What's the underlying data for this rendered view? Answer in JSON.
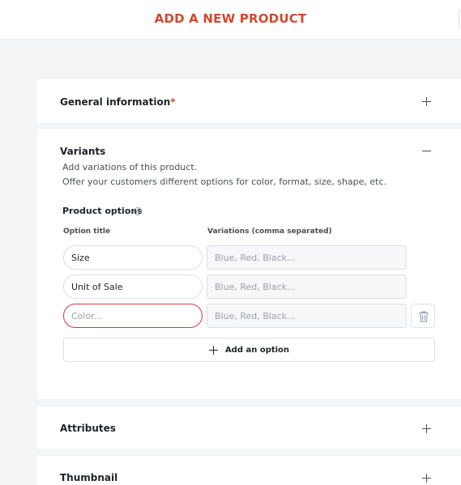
{
  "header": {
    "title": "ADD A NEW PRODUCT"
  },
  "sections": {
    "general": {
      "title": "General information",
      "required_mark": "*"
    },
    "variants": {
      "title": "Variants",
      "description_line1": "Add variations of this product.",
      "description_line2": "Offer your customers different options for color, format, size, shape, etc.",
      "product_options_label": "Product options",
      "info_glyph": "i",
      "col_option_title": "Option title",
      "col_variations": "Variations (comma separated)",
      "options": [
        {
          "title_value": "Size",
          "title_placeholder": "",
          "variations_placeholder": "Blue, Red, Black..."
        },
        {
          "title_value": "Unit of Sale",
          "title_placeholder": "",
          "variations_placeholder": "Blue, Red, Black..."
        },
        {
          "title_value": "",
          "title_placeholder": "Color...",
          "variations_placeholder": "Blue, Red, Black...",
          "invalid": true
        }
      ],
      "add_option_label": "Add an option"
    },
    "attributes": {
      "title": "Attributes"
    },
    "thumbnail": {
      "title": "Thumbnail"
    }
  },
  "colors": {
    "accent": "#d2482b",
    "error_border": "#d33a3a",
    "background": "#f4f5f7"
  },
  "icons": [
    "plus-icon",
    "minus-icon",
    "info-icon",
    "trash-icon"
  ]
}
